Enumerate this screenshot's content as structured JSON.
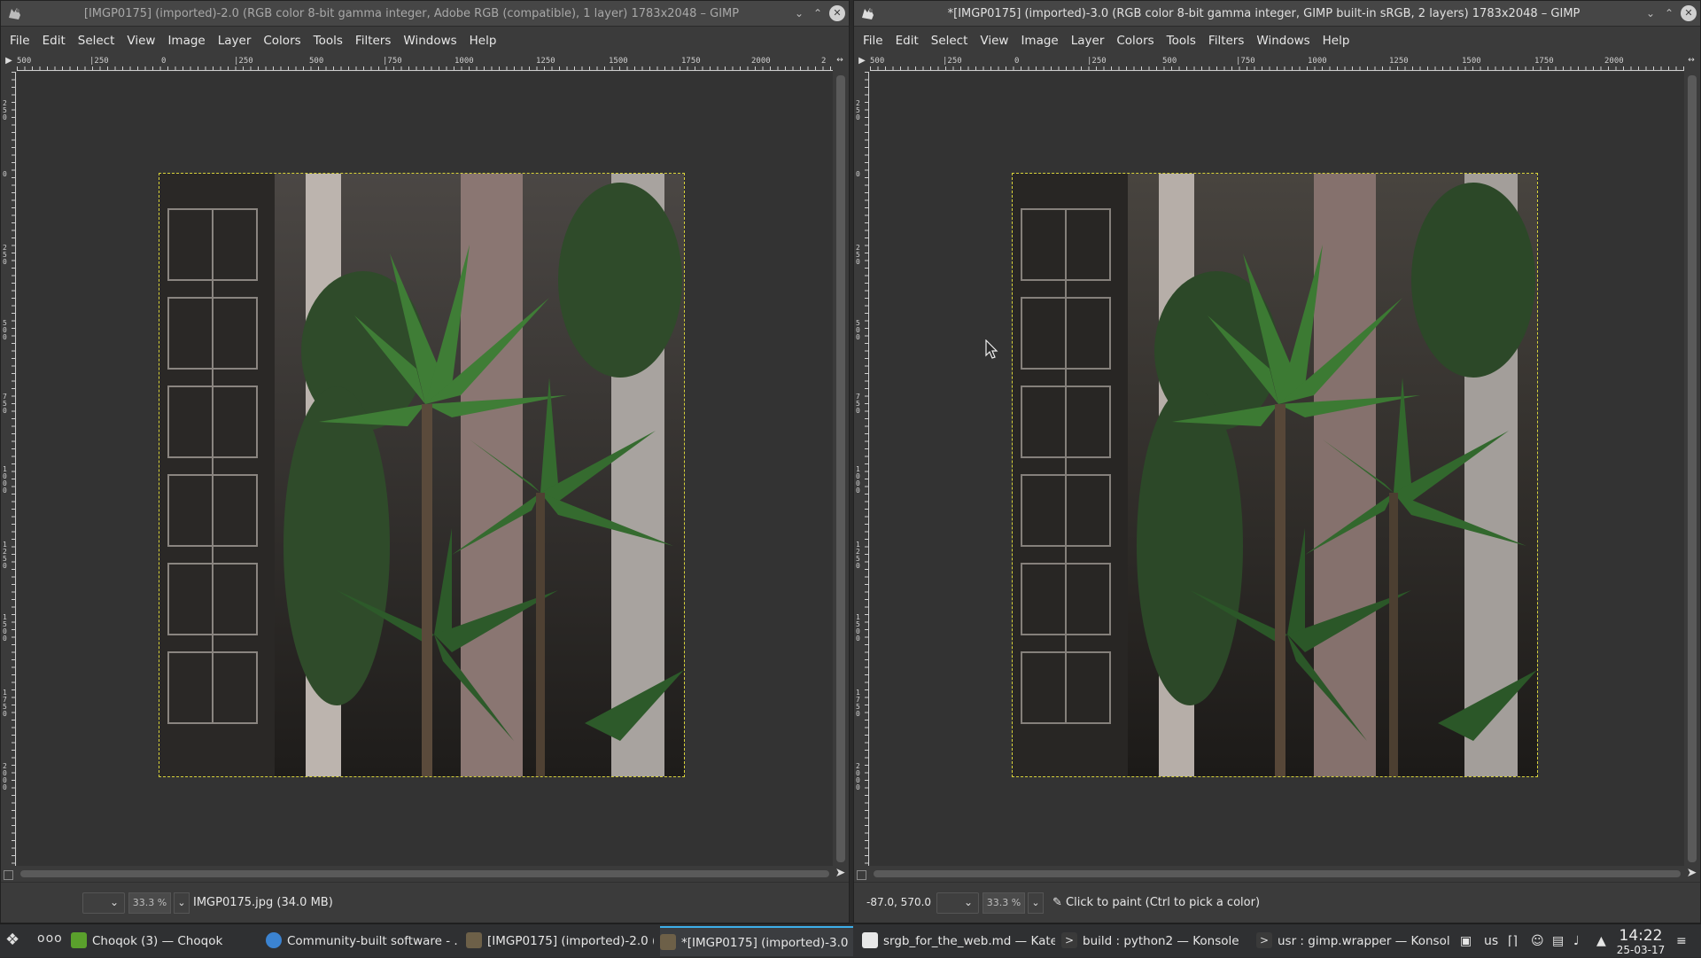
{
  "left_window": {
    "title": "[IMGP0175] (imported)-2.0 (RGB color 8-bit gamma integer, Adobe RGB (compatible), 1 layer) 1783x2048 – GIMP",
    "menu": [
      "File",
      "Edit",
      "Select",
      "View",
      "Image",
      "Layer",
      "Colors",
      "Tools",
      "Filters",
      "Windows",
      "Help"
    ],
    "hruler_labels": [
      "500",
      "|250",
      "0",
      "|250",
      "500",
      "|750",
      "1000",
      "1250",
      "1500",
      "1750",
      "2000",
      "2"
    ],
    "vruler_labels": [
      "250",
      "0",
      "250",
      "500",
      "750",
      "1000",
      "1250",
      "1500",
      "1750",
      "2000"
    ],
    "status": {
      "zoom": "33.3 %",
      "message": "IMGP0175.jpg (34.0 MB)"
    }
  },
  "right_window": {
    "title": "*[IMGP0175] (imported)-3.0 (RGB color 8-bit gamma integer, GIMP built-in sRGB, 2 layers) 1783x2048 – GIMP",
    "menu": [
      "File",
      "Edit",
      "Select",
      "View",
      "Image",
      "Layer",
      "Colors",
      "Tools",
      "Filters",
      "Windows",
      "Help"
    ],
    "hruler_labels": [
      "500",
      "|250",
      "0",
      "|250",
      "500",
      "|750",
      "1000",
      "1250",
      "1500",
      "1750",
      "2000"
    ],
    "vruler_labels": [
      "250",
      "0",
      "250",
      "500",
      "750",
      "1000",
      "1250",
      "1500",
      "1750",
      "2000"
    ],
    "status": {
      "coords": "-87.0, 570.0",
      "zoom": "33.3 %",
      "message": "Click to paint (Ctrl to pick a color)"
    }
  },
  "taskbar": {
    "pager": "ooo",
    "tasks": [
      {
        "label": "Choqok (3) — Choqok",
        "icon_color": "#5aa02c"
      },
      {
        "label": "Community-built software - ...",
        "icon_color": "#3b83d1"
      },
      {
        "label": "[IMGP0175] (imported)-2.0 (...",
        "icon_color": "#6d6048"
      },
      {
        "label": "*[IMGP0175] (imported)-3.0 ...",
        "icon_color": "#6d6048"
      },
      {
        "label": "srgb_for_the_web.md — Kate",
        "icon_color": "#e8e8e8"
      },
      {
        "label": "build : python2 — Konsole",
        "icon_color": "#3a3a3a"
      },
      {
        "label": "usr : gimp.wrapper — Konsole",
        "icon_color": "#3a3a3a"
      }
    ],
    "keyboard_layout": "us",
    "clock_time": "14:22",
    "clock_date": "25-03-17"
  },
  "colors": {
    "selection_border": "#d9d33a",
    "active_task_accent": "#3daee9"
  }
}
